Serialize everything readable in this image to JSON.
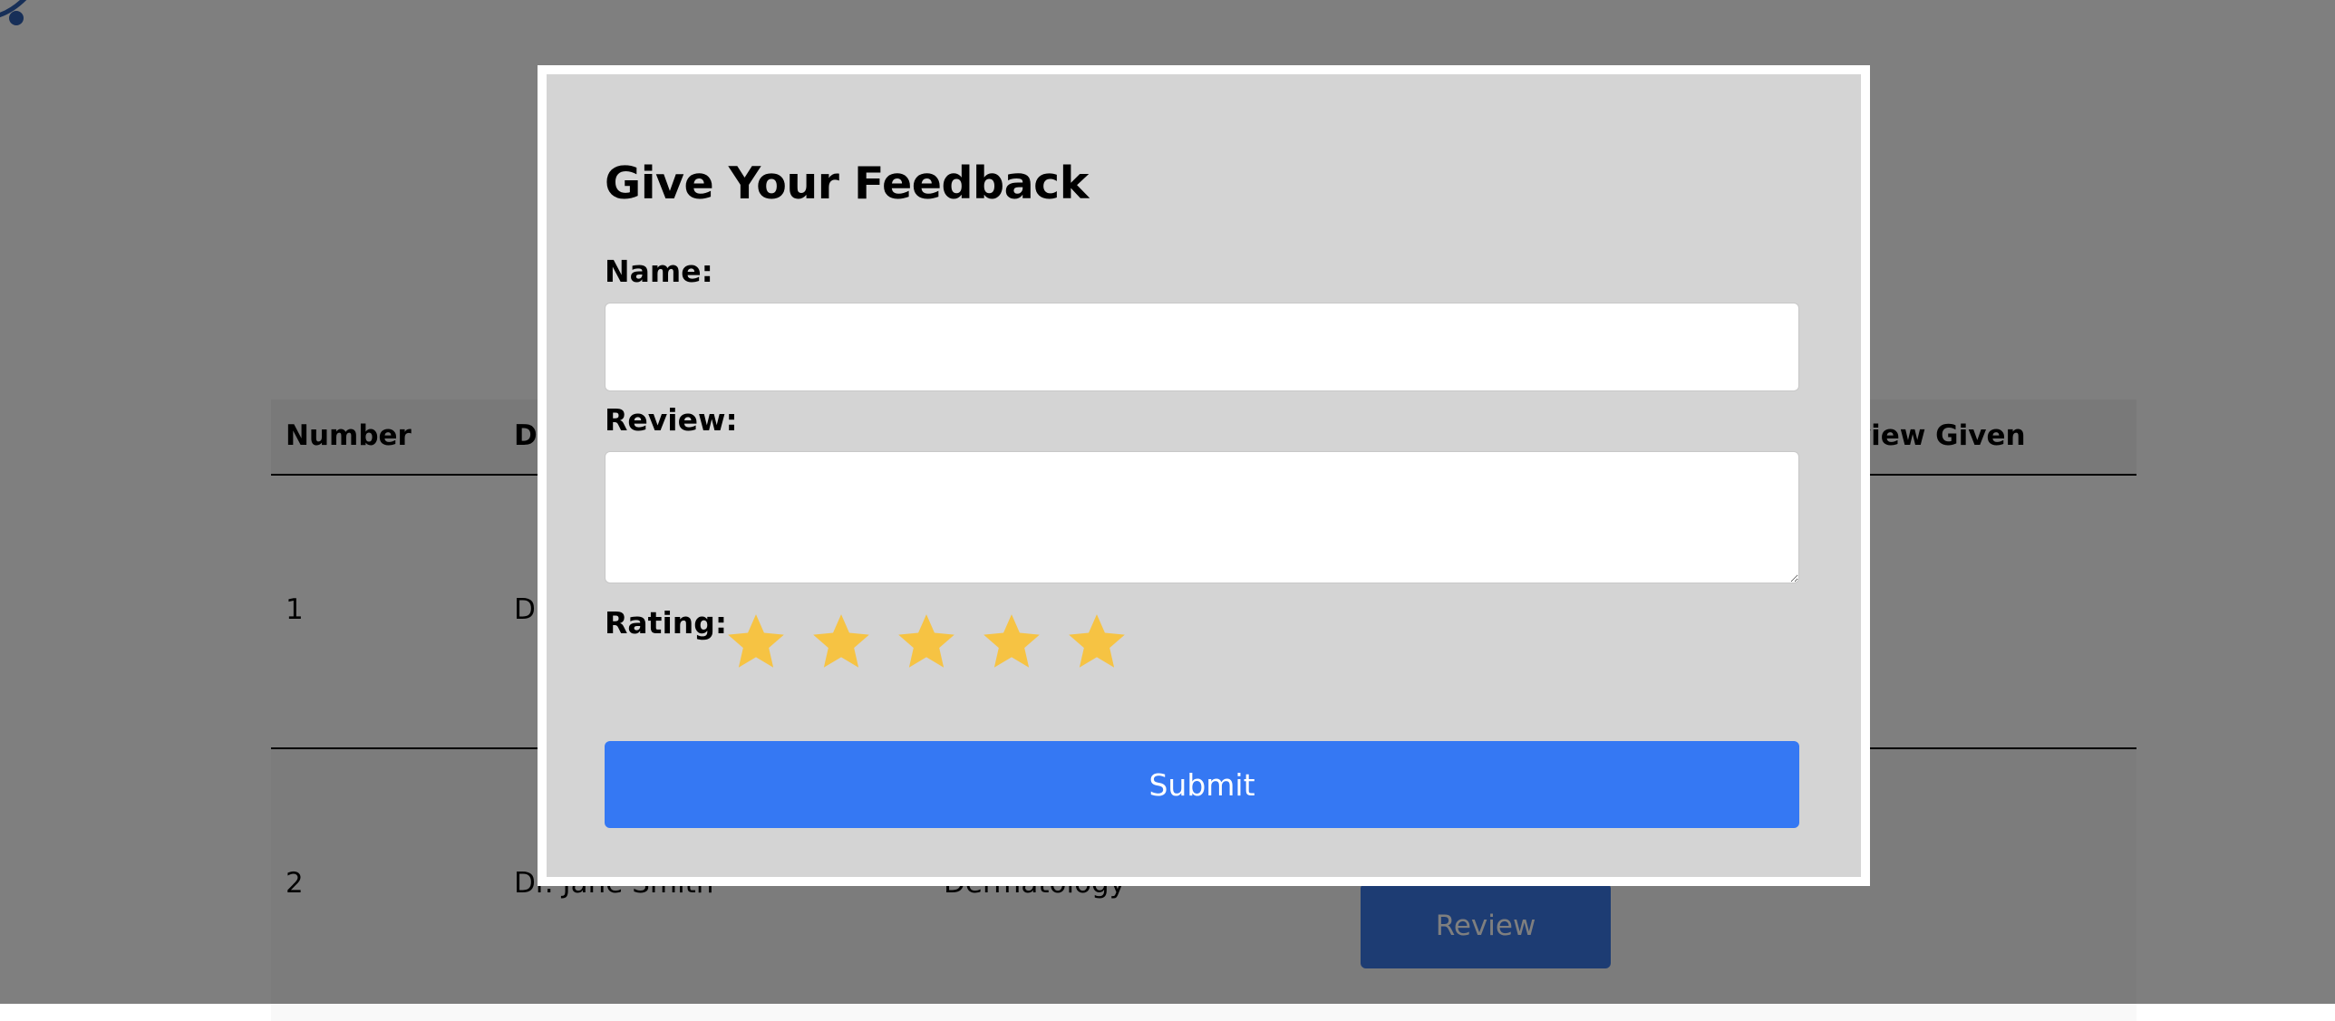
{
  "table": {
    "headers": [
      "Number",
      "Doctor",
      "Review Given"
    ],
    "rows": [
      {
        "number": "1",
        "doctor": "Dr"
      },
      {
        "number": "2",
        "doctor": "Dr. Jane Smith",
        "department": "Dermatology",
        "action_label": "Review"
      }
    ]
  },
  "modal": {
    "title": "Give Your Feedback",
    "name_label": "Name:",
    "name_value": "",
    "review_label": "Review:",
    "review_value": "",
    "rating_label": "Rating:",
    "rating_max": 5,
    "rating_value": 5,
    "submit_label": "Submit"
  },
  "colors": {
    "star": "#f6c343",
    "submit_button": "#3578f3",
    "review_button": "#3b78e7",
    "modal_background": "#d4d4d4",
    "overlay": "rgba(0,0,0,0.5)"
  },
  "icons": {
    "rating": "star-icon",
    "logo": "logo-icon"
  }
}
